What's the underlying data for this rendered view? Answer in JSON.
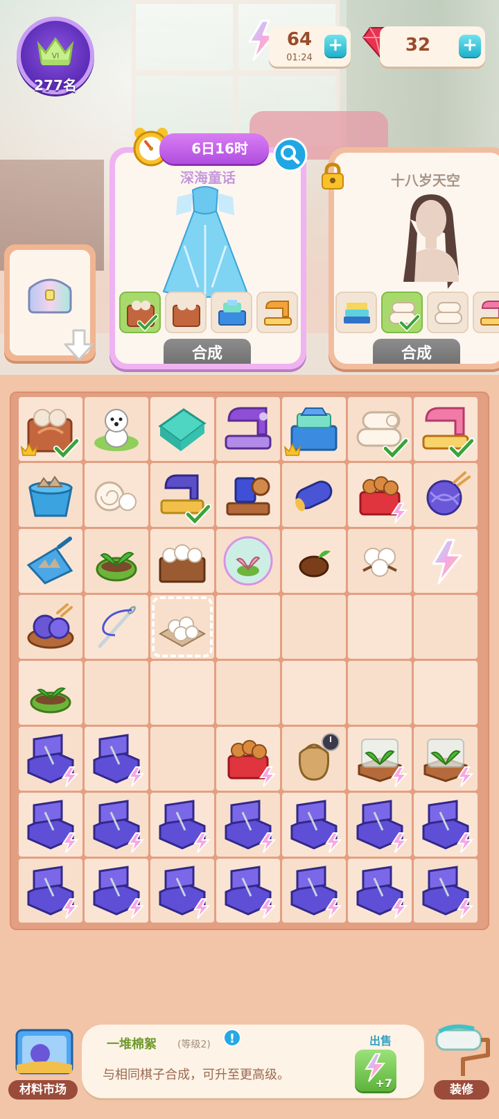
{
  "hud": {
    "rank_label": "277名",
    "rank_badge": "VI",
    "energy_value": "64",
    "energy_timer": "01:24",
    "gem_value": "32",
    "plus": "+"
  },
  "orders": [
    {
      "name": "深海童话",
      "timer": "6日16时",
      "button": "合成",
      "requirements": [
        "bag-of-yarn",
        "bag-of-yarn",
        "fabric-crate",
        "sewing-machine-yellow"
      ],
      "completed": [
        true,
        false,
        false,
        false
      ]
    },
    {
      "name": "十八岁天空",
      "button": "合成",
      "locked": true,
      "requirements": [
        "folded-fabric-stack",
        "cotton-rolls",
        "cotton-rolls",
        "sewing-machine-pink"
      ],
      "completed": [
        false,
        true,
        false,
        false
      ]
    }
  ],
  "board": {
    "columns": 7,
    "rows": 8
  },
  "info": {
    "item_name": "一堆棉絮",
    "item_level": "(等级2)",
    "info_mark": "!",
    "description": "与相同棋子合成，可升至更高级。",
    "sell_label": "出售",
    "sell_amount": "+7"
  },
  "bottom": {
    "market_label": "材料市场",
    "decor_label": "装修"
  },
  "colors": {
    "board": "#e39f82",
    "cell": "#f8dfcc",
    "accent_purple": "#b04ee0",
    "accent_green": "#6f9a2c",
    "accent_teal": "#1fb2cb"
  }
}
